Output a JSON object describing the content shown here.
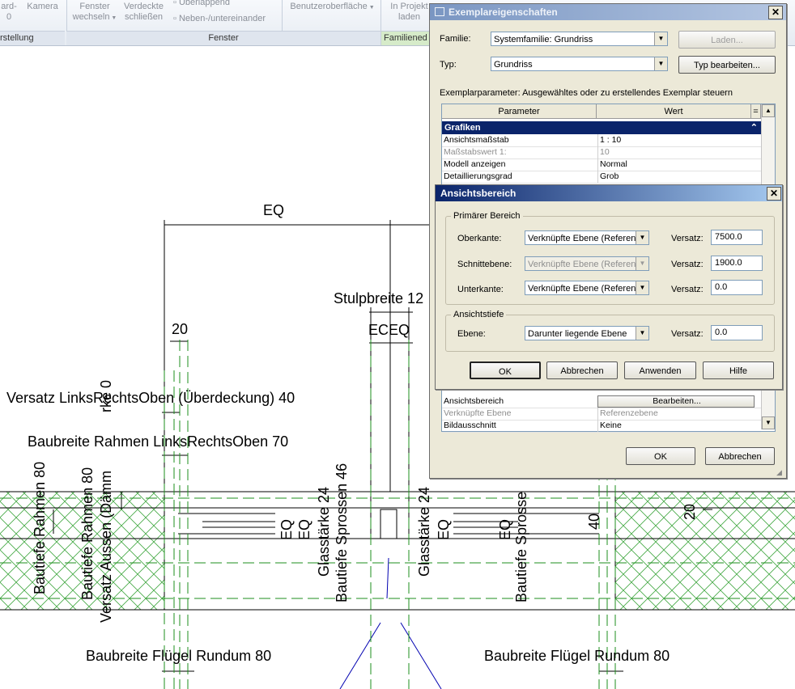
{
  "ribbon": {
    "items": [
      "ard-\n0",
      "Kamera",
      "Fenster\nwechseln",
      "Verdeckte\nschließen",
      "Überlappend",
      "Neben-/untereinander",
      "Benutzeroberfläche",
      "In Projekt\nladen"
    ],
    "panels": [
      "rstellung",
      "Fenster",
      "Familiened"
    ]
  },
  "drawing": {
    "labels": {
      "eq_top": "EQ",
      "stulpbreite": "Stulpbreite 12",
      "eceq": "ECEQ",
      "dim20_left": "20",
      "versatz_lro": "Versatz LinksRechtsOben (Überdeckung) 40",
      "baubreite_rahmen": "Baubreite Rahmen LinksRechtsOben 70",
      "bautiefe_rahmen_1": "Bautiefe Rahmen 80",
      "bautiefe_rahmen_2": "Bautiefe Rahmen 80",
      "versatz_aussen": "Versatz Aussen (Dämm",
      "staerke_0": "rke 0",
      "eq_a": "EQ",
      "eq_b": "EQ",
      "glasstaerke_1": "Glasstärke 24",
      "bautiefe_sprossen": "Bautiefe Sprossen 46",
      "glasstaerke_2": "Glasstärke 24",
      "eq_c": "EQ",
      "eq_d": "EQ",
      "bautiefe_sprosse_r": "Bautiefe Sprosse",
      "dim40": "40",
      "dim20_right": "20",
      "baubreite_fluegel_l": "Baubreite Flügel Rundum 80",
      "baubreite_fluegel_r": "Baubreite Flügel Rundum 80"
    }
  },
  "props_dialog": {
    "title": "Exemplareigenschaften",
    "familie_label": "Familie:",
    "familie_value": "Systemfamilie: Grundriss",
    "typ_label": "Typ:",
    "typ_value": "Grundriss",
    "laden_button": "Laden...",
    "typ_bearbeiten_button": "Typ bearbeiten...",
    "exemplar_caption": "Exemplarparameter: Ausgewähltes oder zu erstellendes Exemplar steuern",
    "col_parameter": "Parameter",
    "col_wert": "Wert",
    "col_eq": "=",
    "group_grafiken": "Grafiken",
    "rows_top": [
      {
        "param": "Ansichtsmaßstab",
        "value": "1 : 10",
        "grey": false
      },
      {
        "param": "Maßstabswert 1:",
        "value": "10",
        "grey": true
      },
      {
        "param": "Modell anzeigen",
        "value": "Normal",
        "grey": false
      },
      {
        "param": "Detaillierungsgrad",
        "value": "Grob",
        "grey": false
      }
    ],
    "rows_bottom": [
      {
        "param": "Ansichtsbereich",
        "value": "Bearbeiten...",
        "grey": false
      },
      {
        "param": "Verknüpfte Ebene",
        "value": "Referenzebene",
        "grey": true
      },
      {
        "param": "Bildausschnitt",
        "value": "Keine",
        "grey": false
      }
    ],
    "ok_button": "OK",
    "cancel_button": "Abbrechen"
  },
  "range_dialog": {
    "title": "Ansichtsbereich",
    "primary_group": "Primärer Bereich",
    "oberkante_label": "Oberkante:",
    "oberkante_value": "Verknüpfte Ebene (Referen",
    "oberkante_offset": "7500.0",
    "schnitt_label": "Schnittebene:",
    "schnitt_value": "Verknüpfte Ebene (Referen",
    "schnitt_offset": "1900.0",
    "unterkante_label": "Unterkante:",
    "unterkante_value": "Verknüpfte Ebene (Referen",
    "unterkante_offset": "0.0",
    "depth_group": "Ansichtstiefe",
    "ebene_label": "Ebene:",
    "ebene_value": "Darunter liegende Ebene",
    "ebene_offset": "0.0",
    "versatz_label": "Versatz:",
    "ok_button": "OK",
    "cancel_button": "Abbrechen",
    "apply_button": "Anwenden",
    "help_button": "Hilfe"
  },
  "colors": {
    "title_active": "#0a246a",
    "title_inactive": "#7a96c2",
    "dialog_bg": "#ece9d8",
    "hatch": "#2e9e2e",
    "centerline": "#1c8f1c",
    "group_header": "#0a246a"
  }
}
